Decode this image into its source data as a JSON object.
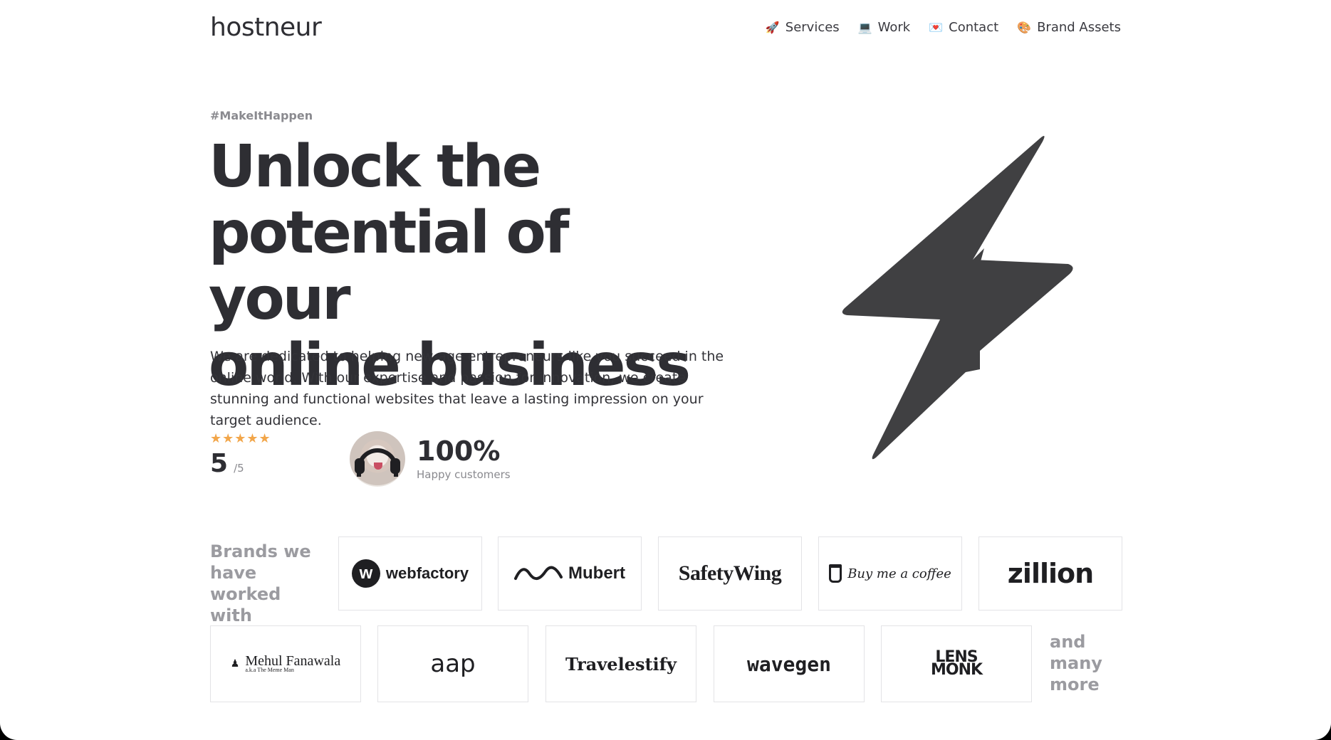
{
  "header": {
    "logo": "hostneur",
    "nav": [
      {
        "label": "Services",
        "icon": "🚀",
        "icon_name": "rocket-icon"
      },
      {
        "label": "Work",
        "icon": "💻",
        "icon_name": "laptop-icon"
      },
      {
        "label": "Contact",
        "icon": "💌",
        "icon_name": "love-letter-icon"
      },
      {
        "label": "Brand Assets",
        "icon": "🎨",
        "icon_name": "palette-icon"
      }
    ]
  },
  "hero": {
    "tag": "#MakeItHappen",
    "headline": [
      "Unlock the",
      "potential of your",
      "online business"
    ],
    "lead": "We are dedicated to helping new-age entrepreneurs like you succeed in the online world. With our expertise and passion for innovation, we create stunning and functional websites that leave a lasting impression on your target audience.",
    "rating": {
      "stars": "★★★★★",
      "score": "5",
      "out_of": "/5"
    },
    "happy": {
      "value": "100%",
      "label": "Happy customers"
    }
  },
  "brands": {
    "title": "Brands we have worked with",
    "more": "and many more",
    "items": [
      {
        "name": "webfactory",
        "mark": "w"
      },
      {
        "name": "Mubert"
      },
      {
        "name": "SafetyWing"
      },
      {
        "name": "Buy me a coffee"
      },
      {
        "name": "zillion"
      },
      {
        "name": "Mehul Fanawala",
        "sub": "a.k.a The Meme Man"
      },
      {
        "name": "aap"
      },
      {
        "name": "Travelestify"
      },
      {
        "name": "wavegen"
      },
      {
        "name": "LENS",
        "name2": "MONK"
      }
    ]
  },
  "colors": {
    "text": "#2e2e33",
    "muted": "#9b9ba0",
    "star": "#f2a64a",
    "bolt": "#404042"
  }
}
